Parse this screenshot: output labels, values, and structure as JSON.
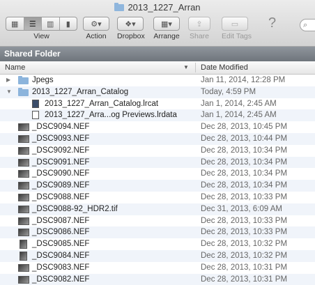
{
  "window": {
    "title": "2013_1227_Arran"
  },
  "toolbar": {
    "view_label": "View",
    "action_label": "Action",
    "dropbox_label": "Dropbox",
    "arrange_label": "Arrange",
    "share_label": "Share",
    "edittags_label": "Edit Tags",
    "help_glyph": "?"
  },
  "section": {
    "title": "Shared Folder"
  },
  "columns": {
    "name": "Name",
    "date": "Date Modified"
  },
  "rows": [
    {
      "name": "Jpegs",
      "date": "Jan 11, 2014, 12:28 PM",
      "icon": "folder-icon",
      "expanded": false
    },
    {
      "name": "2013_1227_Arran_Catalog",
      "date": "Today, 4:59 PM",
      "icon": "folder-icon",
      "expanded": true
    },
    {
      "name": "2013_1227_Arran_Catalog.lrcat",
      "date": "Jan 1, 2014, 2:45 AM",
      "icon": "lrcat-file-icon"
    },
    {
      "name": "2013_1227_Arra...og Previews.lrdata",
      "date": "Jan 1, 2014, 2:45 AM",
      "icon": "lrdata-file-icon"
    },
    {
      "name": "_DSC9094.NEF",
      "date": "Dec 28, 2013, 10:45 PM",
      "icon": "image-thumbnail-icon"
    },
    {
      "name": "_DSC9093.NEF",
      "date": "Dec 28, 2013, 10:44 PM",
      "icon": "image-thumbnail-icon"
    },
    {
      "name": "_DSC9092.NEF",
      "date": "Dec 28, 2013, 10:34 PM",
      "icon": "image-thumbnail-icon"
    },
    {
      "name": "_DSC9091.NEF",
      "date": "Dec 28, 2013, 10:34 PM",
      "icon": "image-thumbnail-icon"
    },
    {
      "name": "_DSC9090.NEF",
      "date": "Dec 28, 2013, 10:34 PM",
      "icon": "image-thumbnail-icon"
    },
    {
      "name": "_DSC9089.NEF",
      "date": "Dec 28, 2013, 10:34 PM",
      "icon": "image-thumbnail-icon"
    },
    {
      "name": "_DSC9088.NEF",
      "date": "Dec 28, 2013, 10:33 PM",
      "icon": "image-thumbnail-icon"
    },
    {
      "name": "_DSC9088-92_HDR2.tif",
      "date": "Dec 31, 2013, 6:09 AM",
      "icon": "image-thumbnail-icon"
    },
    {
      "name": "_DSC9087.NEF",
      "date": "Dec 28, 2013, 10:33 PM",
      "icon": "image-thumbnail-icon"
    },
    {
      "name": "_DSC9086.NEF",
      "date": "Dec 28, 2013, 10:33 PM",
      "icon": "image-thumbnail-icon"
    },
    {
      "name": "_DSC9085.NEF",
      "date": "Dec 28, 2013, 10:32 PM",
      "icon": "image-thumbnail-portrait-icon"
    },
    {
      "name": "_DSC9084.NEF",
      "date": "Dec 28, 2013, 10:32 PM",
      "icon": "image-thumbnail-portrait-icon"
    },
    {
      "name": "_DSC9083.NEF",
      "date": "Dec 28, 2013, 10:31 PM",
      "icon": "image-thumbnail-icon"
    },
    {
      "name": "_DSC9082.NEF",
      "date": "Dec 28, 2013, 10:31 PM",
      "icon": "image-thumbnail-icon"
    }
  ]
}
